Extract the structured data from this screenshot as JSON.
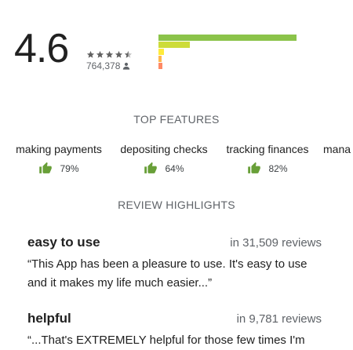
{
  "rating": {
    "score": "4.6",
    "star_count_filled": 4.5,
    "total_ratings": "764,378",
    "histogram": [
      {
        "stars": 5,
        "fraction": 0.88,
        "color": "#8bc34a"
      },
      {
        "stars": 4,
        "fraction": 0.2,
        "color": "#cddc39"
      },
      {
        "stars": 3,
        "fraction": 0.035,
        "color": "#ffeb3b"
      },
      {
        "stars": 2,
        "fraction": 0.02,
        "color": "#ffb74d"
      },
      {
        "stars": 1,
        "fraction": 0.025,
        "color": "#ff8a65"
      }
    ]
  },
  "top_features": {
    "heading": "TOP FEATURES",
    "items": [
      {
        "name": "making payments",
        "percent": "79%"
      },
      {
        "name": "depositing checks",
        "percent": "64%"
      },
      {
        "name": "tracking finances",
        "percent": "82%"
      },
      {
        "name": "mana",
        "percent": ""
      }
    ],
    "thumb_color": "#689f38"
  },
  "review_highlights": {
    "heading": "REVIEW HIGHLIGHTS",
    "items": [
      {
        "title": "easy to use",
        "count": "in 31,509 reviews",
        "quote": "“This App has been a pleasure to use. It's easy to use and it makes my life much easier...”"
      },
      {
        "title": "helpful",
        "count": "in 9,781 reviews",
        "quote": "“...That's EXTREMELY helpful for those few times I'm"
      }
    ]
  }
}
